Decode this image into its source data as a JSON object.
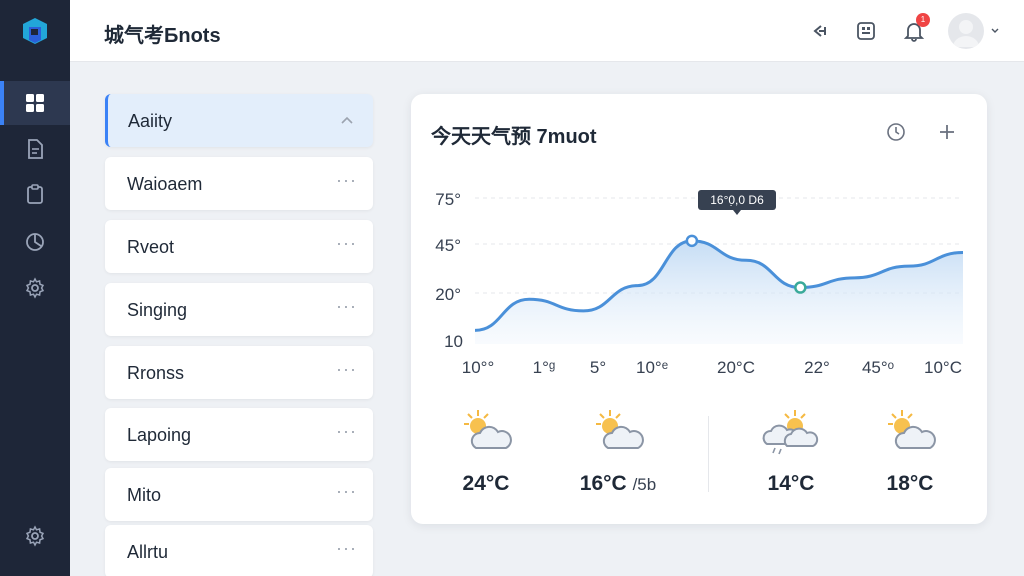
{
  "app": {
    "title": "城气考Бnots"
  },
  "header": {
    "icons": [
      "back-icon",
      "grid-icon",
      "bell-icon",
      "avatar-icon",
      "chevron-down-icon"
    ],
    "notification_count": "1"
  },
  "rail": {
    "items": [
      "dashboard-icon",
      "document-icon",
      "clipboard-icon",
      "chart-pie-icon",
      "gear-icon"
    ],
    "bottom": "gear-icon",
    "accent": "#3b82f6",
    "background": "#1e2638"
  },
  "list": {
    "items": [
      {
        "label": "Aaiity"
      },
      {
        "label": "Waioaem"
      },
      {
        "label": "Rveot"
      },
      {
        "label": "Singing"
      },
      {
        "label": "Rronss"
      },
      {
        "label": "Lapoing"
      },
      {
        "label": "Mito"
      },
      {
        "label": "Allrtu"
      }
    ],
    "more_label": "···"
  },
  "card": {
    "title": "今天天气预 7muot",
    "icons": [
      "clock-icon",
      "plus-icon"
    ]
  },
  "chart_data": {
    "type": "area",
    "y_ticks": [
      "75°",
      "45°",
      "20°",
      "10"
    ],
    "x_ticks": [
      "10°°",
      "1°ᵍ",
      "5°",
      "10°ᵉ",
      "20°C",
      "22°",
      "45°ᵒ",
      "10°C"
    ],
    "series": [
      {
        "values": [
          12,
          28,
          22,
          35,
          58,
          48,
          34,
          39,
          45,
          52
        ]
      }
    ],
    "ylim": [
      5,
      80
    ],
    "tooltip": "16°0̣,0 D6",
    "grid": true,
    "line_color": "#4a90d9"
  },
  "forecast": [
    {
      "icon": "partly-cloudy-icon",
      "temp": "24°C",
      "extra": ""
    },
    {
      "icon": "partly-cloudy-icon",
      "temp": "16°C",
      "extra": "/5b"
    },
    {
      "icon": "rain-cloud-sun-icon",
      "temp": "14°C",
      "extra": ""
    },
    {
      "icon": "partly-cloudy-icon",
      "temp": "18°C",
      "extra": ""
    }
  ]
}
